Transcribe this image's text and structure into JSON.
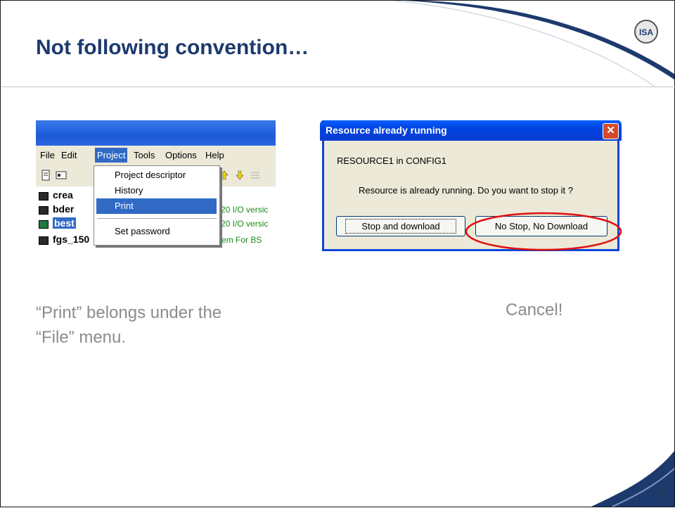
{
  "slide": {
    "title": "Not following convention…",
    "page_number": "5",
    "logo_text": "ISA",
    "caption_left_line1": "“Print” belongs under the",
    "caption_left_line2": "“File” menu.",
    "caption_right": "Cancel!"
  },
  "screenshot_menu": {
    "menubar": [
      "File",
      "Edit",
      "Project",
      "Tools",
      "Options",
      "Help"
    ],
    "active_menu": "Project",
    "dropdown_items": [
      "Project descriptor",
      "History",
      "Print",
      "Set password"
    ],
    "highlighted_item": "Print",
    "rows": [
      {
        "name": "crea",
        "desc": ""
      },
      {
        "name": "bder",
        "desc": "20 I/O versic"
      },
      {
        "name": "best",
        "desc": "20 I/O versic"
      },
      {
        "name": "fgs_150",
        "desc": "Fire & Gas System For BS"
      }
    ]
  },
  "dialog": {
    "title": "Resource already running",
    "close_glyph": "✕",
    "line1": "RESOURCE1 in CONFIG1",
    "line2": "Resource is already running. Do you want to stop it ?",
    "button_primary": "Stop and download",
    "button_secondary": "No Stop, No Download"
  },
  "colors": {
    "title": "#1d3a6e",
    "xp_blue": "#0a46d6",
    "highlight": "#316ac5",
    "annotation_red": "#e01010"
  }
}
